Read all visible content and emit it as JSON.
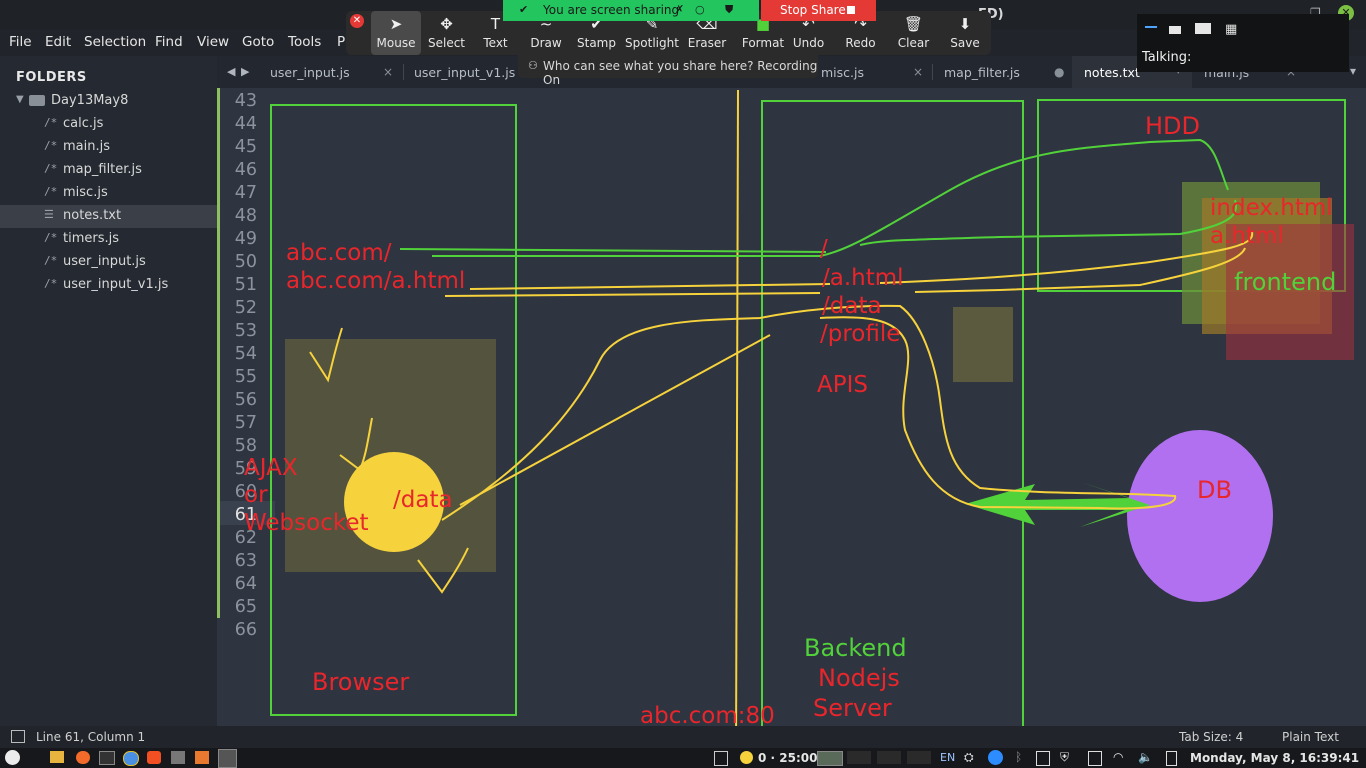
{
  "window": {
    "title_fragment": "ED)"
  },
  "menubar": [
    "File",
    "Edit",
    "Selection",
    "Find",
    "View",
    "Goto",
    "Tools",
    "P"
  ],
  "sidebar": {
    "title": "FOLDERS",
    "folder": "Day13May8",
    "files": [
      {
        "icon": "/*",
        "name": "calc.js"
      },
      {
        "icon": "/*",
        "name": "main.js"
      },
      {
        "icon": "/*",
        "name": "map_filter.js"
      },
      {
        "icon": "/*",
        "name": "misc.js"
      },
      {
        "icon": "☰",
        "name": "notes.txt"
      },
      {
        "icon": "/*",
        "name": "timers.js"
      },
      {
        "icon": "/*",
        "name": "user_input.js"
      },
      {
        "icon": "/*",
        "name": "user_input_v1.js"
      }
    ]
  },
  "tabs": [
    {
      "label": "user_input.js",
      "close": "×"
    },
    {
      "label": "user_input_v1.js",
      "close": "×"
    },
    {
      "label": "misc.js",
      "close": "×"
    },
    {
      "label": "map_filter.js",
      "close": "●"
    },
    {
      "label": "notes.txt",
      "close": ""
    },
    {
      "label": "main.js",
      "close": "×"
    }
  ],
  "line_numbers": [
    "43",
    "44",
    "45",
    "46",
    "47",
    "48",
    "49",
    "50",
    "51",
    "52",
    "53",
    "54",
    "55",
    "56",
    "57",
    "58",
    "59",
    "60",
    "61",
    "62",
    "63",
    "64",
    "65",
    "66"
  ],
  "current_line": "61",
  "zoom_toolbar": {
    "tools": [
      {
        "icon": "mouse-pointer-icon",
        "glyph": "➤",
        "label": "Mouse"
      },
      {
        "icon": "move-icon",
        "glyph": "✥",
        "label": "Select"
      },
      {
        "icon": "text-icon",
        "glyph": "T",
        "label": "Text"
      },
      {
        "icon": "draw-icon",
        "glyph": "∼",
        "label": "Draw"
      },
      {
        "icon": "stamp-icon",
        "glyph": "✔",
        "label": "Stamp"
      },
      {
        "icon": "spotlight-icon",
        "glyph": "✎",
        "label": "Spotlight"
      },
      {
        "icon": "eraser-icon",
        "glyph": "⌫",
        "label": "Eraser"
      },
      {
        "icon": "format-icon",
        "glyph": "■",
        "label": "Format"
      },
      {
        "icon": "undo-icon",
        "glyph": "↶",
        "label": "Undo"
      },
      {
        "icon": "redo-icon",
        "glyph": "↷",
        "label": "Redo"
      },
      {
        "icon": "trash-icon",
        "glyph": "🗑",
        "label": "Clear"
      },
      {
        "icon": "save-icon",
        "glyph": "⬇",
        "label": "Save"
      }
    ],
    "sharing_text": "You are screen sharing",
    "stop_share": "Stop Share",
    "who_can_see": "Who can see what you share here? Recording On",
    "talking": "Talking:"
  },
  "drawing": {
    "browser_url1": "abc.com/",
    "browser_url2": "abc.com/a.html",
    "ajax1": "AJAX",
    "ajax2": "or",
    "ajax3": "Websocket",
    "data_circle": "/data",
    "browser": "Browser",
    "port": "abc.com:80",
    "route_root": "/",
    "route_a": "/a.html",
    "route_data": "/data",
    "route_profile": "/profile",
    "apis": "APIS",
    "backend1": "Backend",
    "backend2": "Nodejs",
    "backend3": "Server",
    "hdd": "HDD",
    "index": "index.html",
    "ahtml": "a.html",
    "frontend": "frontend",
    "db": "DB"
  },
  "statusbar": {
    "position": "Line 61, Column 1",
    "tab_size": "Tab Size: 4",
    "syntax": "Plain Text"
  },
  "taskbar": {
    "timer": "0 · 25:00",
    "lang": "EN",
    "clock": "Monday, May 8, 16:39:41"
  },
  "colors": {
    "red_ink": "#e8262b",
    "green_ink": "#52d23a",
    "yellow_ink": "#f6d23c",
    "purple": "#b070f0"
  }
}
